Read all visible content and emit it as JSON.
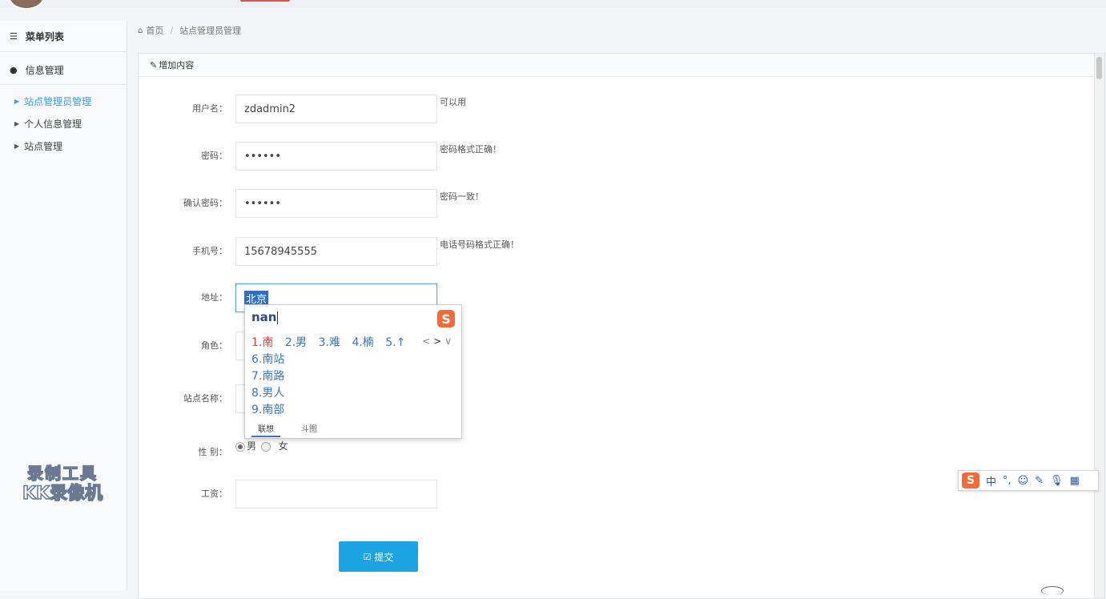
{
  "sidebar": {
    "header": "菜单列表",
    "group": "信息管理",
    "items": [
      {
        "label": "站点管理员管理",
        "active": true
      },
      {
        "label": "个人信息管理",
        "active": false
      },
      {
        "label": "站点管理",
        "active": false
      }
    ]
  },
  "breadcrumb": {
    "home": "首页",
    "current": "站点管理员管理"
  },
  "panel": {
    "title": "增加内容"
  },
  "form": {
    "username": {
      "label": "用户名：",
      "value": "zdadmin2",
      "hint": "可以用"
    },
    "password": {
      "label": "密码：",
      "value": "••••••",
      "hint": "密码格式正确！"
    },
    "confirm": {
      "label": "确认密码：",
      "value": "••••••",
      "hint": "密码一致！"
    },
    "phone": {
      "label": "手机号：",
      "value": "15678945555",
      "hint": "电话号码格式正确！"
    },
    "address": {
      "label": "地址：",
      "value": "北京"
    },
    "role": {
      "label": "角色："
    },
    "site_name": {
      "label": "站点名称："
    },
    "gender": {
      "label": "性 别：",
      "options": [
        "男",
        "女"
      ],
      "selected": "男"
    },
    "salary": {
      "label": "工资：",
      "value": ""
    },
    "submit": "提交"
  },
  "ime_popup": {
    "composition": "nan",
    "logo": "S",
    "first_row": [
      "1.南",
      "2.男",
      "3.难",
      "4.楠",
      "5.↑"
    ],
    "nav": [
      "<",
      ">",
      "∨"
    ],
    "candidates": [
      "6.南站",
      "7.南路",
      "8.男人",
      "9.南部"
    ],
    "tabs": [
      "联想",
      "斗图"
    ]
  },
  "ime_bar": {
    "logo": "S",
    "items": [
      "中",
      "°,",
      "☺",
      "✎",
      "🎙",
      "▦"
    ]
  },
  "watermark": {
    "line1": "录制工具",
    "line2": "KK录像机"
  },
  "colors": {
    "accent": "#1ca3e3",
    "link_active": "#3a9fd8",
    "ime_orange": "#f26a3a"
  }
}
